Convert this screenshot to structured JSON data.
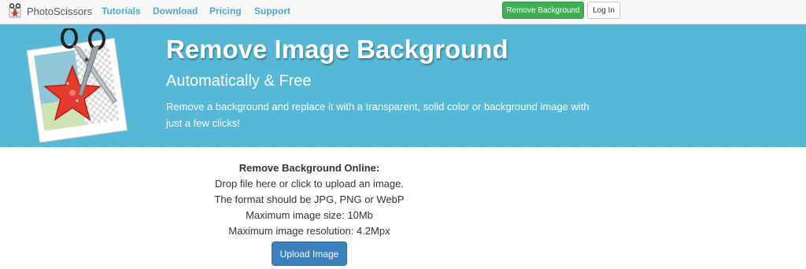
{
  "brand": {
    "name": "PhotoScissors",
    "icon": "scissors-logo-icon"
  },
  "nav": {
    "links": [
      "Tutorials",
      "Download",
      "Pricing",
      "Support"
    ],
    "remove_button": "Remove Background",
    "login_button": "Log In"
  },
  "colors": {
    "hero_bg": "#56b8d6",
    "nav_link": "#49a9ce",
    "remove_btn": "#3fae56",
    "upload_btn": "#3a7fbe"
  },
  "hero": {
    "title": "Remove Image Background",
    "subtitle": "Automatically & Free",
    "description": "Remove a background and replace it with a transparent, solid color or background image with just a few clicks!",
    "illustration": "starfish-photo-with-scissors-icon"
  },
  "upload": {
    "title": "Remove Background Online:",
    "lines": [
      "Drop file here or click to upload an image.",
      "The format should be JPG, PNG or WebP",
      "Maximum image size: 10Mb",
      "Maximum image resolution: 4.2Mpx"
    ],
    "button": "Upload Image"
  }
}
